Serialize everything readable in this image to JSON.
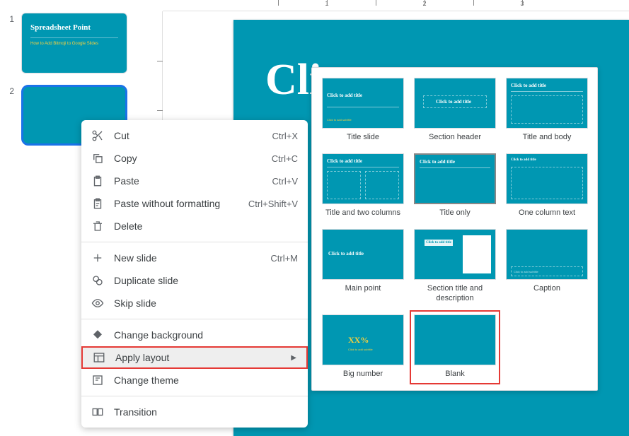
{
  "thumbs": [
    {
      "num": "1",
      "title": "Spreadsheet Point",
      "sub": "How to Add Bitmoji to Google Slides"
    },
    {
      "num": "2"
    }
  ],
  "slide": {
    "title": "Cli"
  },
  "ruler": {
    "labels": [
      "1",
      "2",
      "3"
    ]
  },
  "ctx": {
    "cut": "Cut",
    "cut_sc": "Ctrl+X",
    "copy": "Copy",
    "copy_sc": "Ctrl+C",
    "paste": "Paste",
    "paste_sc": "Ctrl+V",
    "pwf": "Paste without formatting",
    "pwf_sc": "Ctrl+Shift+V",
    "delete": "Delete",
    "new": "New slide",
    "new_sc": "Ctrl+M",
    "dup": "Duplicate slide",
    "skip": "Skip slide",
    "bg": "Change background",
    "layout": "Apply layout",
    "theme": "Change theme",
    "trans": "Transition"
  },
  "layouts": {
    "l1": "Title slide",
    "l2": "Section header",
    "l3": "Title and body",
    "l4": "Title and two columns",
    "l5": "Title only",
    "l6": "One column text",
    "l7": "Main point",
    "l8": "Section title and description",
    "l9": "Caption",
    "l10": "Big number",
    "l11": "Blank",
    "ph_title": "Click to add title",
    "ph_sub": "Click to add subtitle",
    "ph_xx": "XX%"
  }
}
